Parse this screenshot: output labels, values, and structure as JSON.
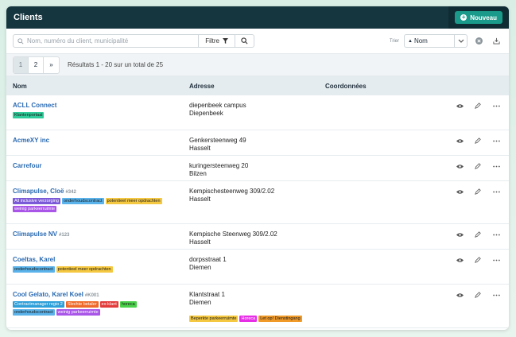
{
  "header": {
    "title": "Clients",
    "new_button": "Nouveau"
  },
  "toolbar": {
    "search_placeholder": "Nom, numéro du client, municipalité",
    "filter_label": "Filtre",
    "sort_label": "Trier",
    "sort_value": "Nom"
  },
  "pagination": {
    "pages": [
      "1",
      "2",
      "»"
    ],
    "results": "Résultats 1 - 20 sur un total de 25"
  },
  "columns": {
    "name": "Nom",
    "address": "Adresse",
    "coords": "Coordonnées"
  },
  "rows": [
    {
      "name": "ACLL Connect",
      "num": "",
      "addr1": "diepenbeek campus",
      "addr2": "Diepenbeek",
      "tags": [
        {
          "t": "Klantenportaal",
          "c": "#2ecc9a"
        }
      ],
      "addr_tags": []
    },
    {
      "name": "AcmeXY inc",
      "num": "",
      "addr1": "Genkersteenweg 49",
      "addr2": "Hasselt",
      "tags": [],
      "addr_tags": []
    },
    {
      "name": "Carrefour",
      "num": "",
      "addr1": "kuringersteenweg 20",
      "addr2": "Bilzen",
      "tags": [],
      "addr_tags": []
    },
    {
      "name": "Climapulse, Cloë",
      "num": "#342",
      "addr1": "Kempischesteenweg 309/2.02",
      "addr2": "Hasselt",
      "tags": [
        {
          "t": "All inclusive verzorging",
          "c": "#7b5ad8",
          "w": true
        },
        {
          "t": "onderhoudscontract",
          "c": "#5ab3ea"
        },
        {
          "t": "potentieel meer opdrachten",
          "c": "#f5c842"
        },
        {
          "t": "weinig parkeerruimte",
          "c": "#a855e8",
          "w": true
        }
      ],
      "addr_tags": []
    },
    {
      "name": "Climapulse NV",
      "num": "#123",
      "addr1": "Kempische Steenweg 309/2.02",
      "addr2": "Hasselt",
      "tags": [],
      "addr_tags": []
    },
    {
      "name": "Coeltas, Karel",
      "num": "",
      "addr1": "dorpsstraat 1",
      "addr2": "Diemen",
      "tags": [
        {
          "t": "onderhoudscontract",
          "c": "#5ab3ea"
        },
        {
          "t": "potentieel meer opdrachten",
          "c": "#f5c842"
        }
      ],
      "addr_tags": []
    },
    {
      "name": "Cool Gelato, Karel Koel",
      "num": "#K001",
      "addr1": "Klantstraat 1",
      "addr2": "Diemen",
      "tags": [
        {
          "t": "Contractmanager regio 2",
          "c": "#2e9fd8",
          "w": true
        },
        {
          "t": "Slechte betaler",
          "c": "#ef6a2a",
          "w": true
        },
        {
          "t": "ex-klant",
          "c": "#e23b3b",
          "w": true
        },
        {
          "t": "horeca",
          "c": "#4ad24a"
        },
        {
          "t": "onderhoudscontract",
          "c": "#5ab3ea"
        },
        {
          "t": "weinig parkeerruimte",
          "c": "#a855e8",
          "w": true
        }
      ],
      "addr_tags": [
        {
          "t": "Beperkte parkeerruimte",
          "c": "#f5c842"
        },
        {
          "t": "Horeca",
          "c": "#e62ee6",
          "w": true
        },
        {
          "t": "Let op! Dienstingang",
          "c": "#f09a2a"
        }
      ]
    }
  ]
}
